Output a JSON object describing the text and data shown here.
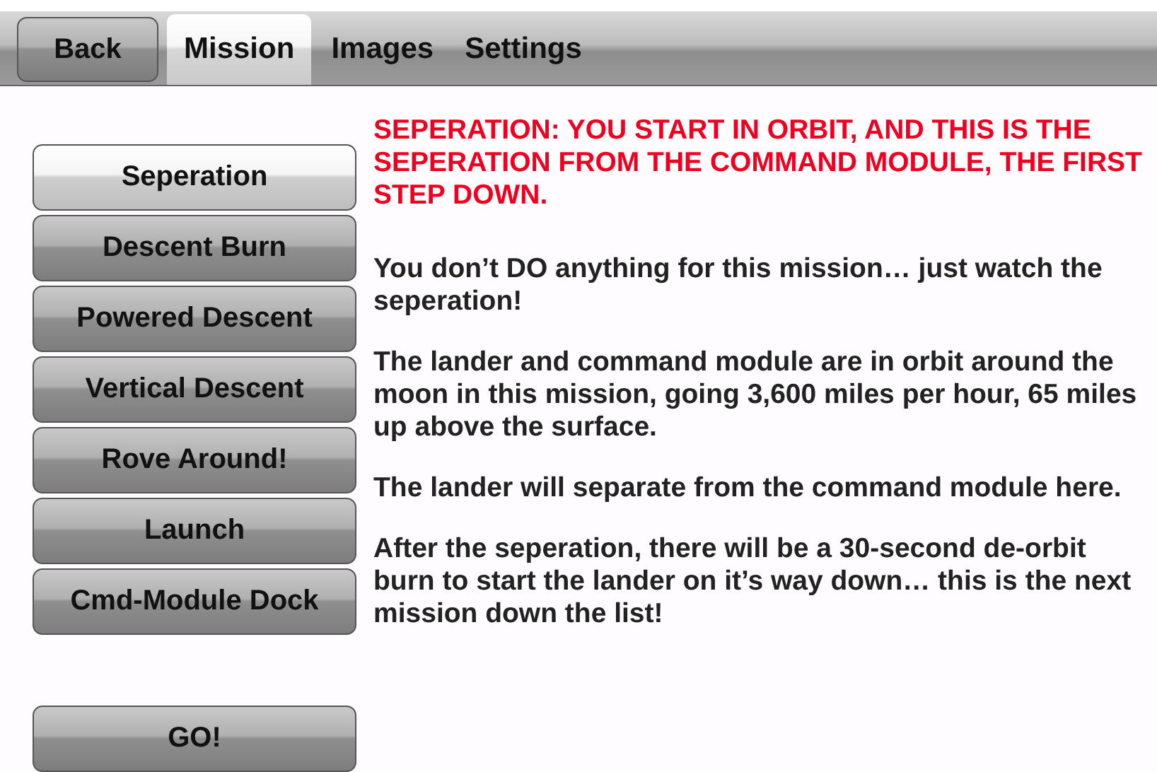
{
  "toolbar": {
    "back_button": "Back",
    "tabs": [
      {
        "label": "Mission",
        "selected": true
      },
      {
        "label": "Images",
        "selected": false
      },
      {
        "label": "Settings",
        "selected": false
      }
    ]
  },
  "missions": [
    {
      "label": "Seperation",
      "selected": true
    },
    {
      "label": "Descent Burn",
      "selected": false
    },
    {
      "label": "Powered Descent",
      "selected": false
    },
    {
      "label": "Vertical Descent",
      "selected": false
    },
    {
      "label": "Rove Around!",
      "selected": false
    },
    {
      "label": "Launch",
      "selected": false
    },
    {
      "label": "Cmd-Module Dock",
      "selected": false
    }
  ],
  "go_button": "GO!",
  "description": {
    "heading": "SEPERATION: YOU START IN ORBIT, AND THIS IS THE SEPERATION FROM THE COMMAND MODULE, THE FIRST STEP DOWN.",
    "paragraphs": [
      "You don’t DO anything for this mission… just watch the seperation!",
      "The lander and command module are in orbit around the moon in this mission, going 3,600 miles per hour, 65 miles up above the surface.",
      "The lander will separate from the command module here.",
      "After the seperation, there will be a 30-second de-orbit burn to start the lander on it’s way down… this is the next mission down the list!"
    ]
  }
}
